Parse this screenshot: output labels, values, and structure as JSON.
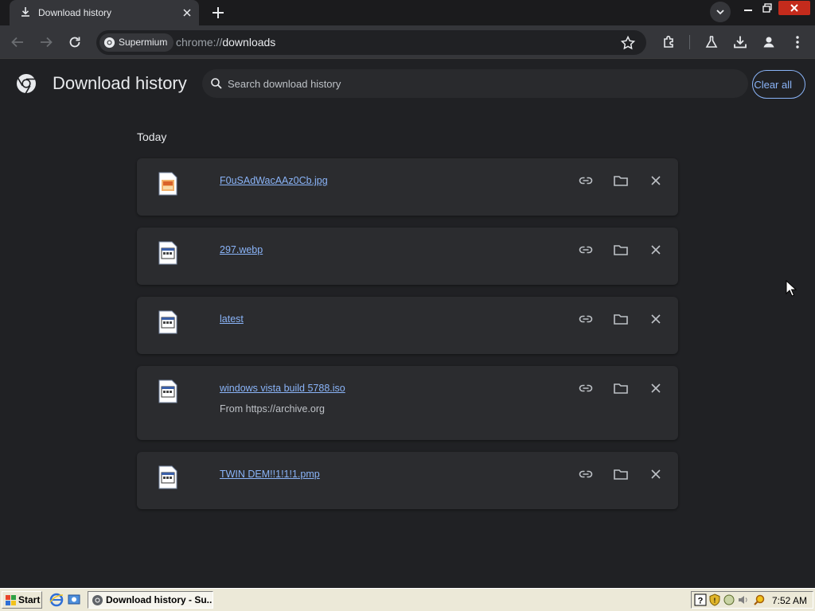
{
  "browser": {
    "tab": {
      "title": "Download history"
    },
    "address": {
      "site_chip": "Supermium",
      "url_scheme": "chrome://",
      "url_host": "downloads"
    }
  },
  "page": {
    "title": "Download history",
    "search_placeholder": "Search download history",
    "clear_all_label": "Clear all",
    "section_date": "Today"
  },
  "downloads": [
    {
      "name": "F0uSAdWacAAz0Cb.jpg",
      "source": "",
      "icon": "image-file-icon"
    },
    {
      "name": "297.webp",
      "source": "",
      "icon": "generic-file-icon"
    },
    {
      "name": "latest",
      "source": "",
      "icon": "generic-file-icon"
    },
    {
      "name": "windows vista build 5788.iso",
      "source": "From https://archive.org",
      "icon": "generic-file-icon"
    },
    {
      "name": "TWIN DEM!!1!1!1.pmp",
      "source": "",
      "icon": "generic-file-icon"
    }
  ],
  "taskbar": {
    "start_label": "Start",
    "task_label": "Download history - Su...",
    "clock": "7:52 AM"
  },
  "colors": {
    "page_bg": "#202124",
    "card_bg": "#2b2c2f",
    "link": "#8ab4f8",
    "taskbar": "#ece9d8"
  }
}
